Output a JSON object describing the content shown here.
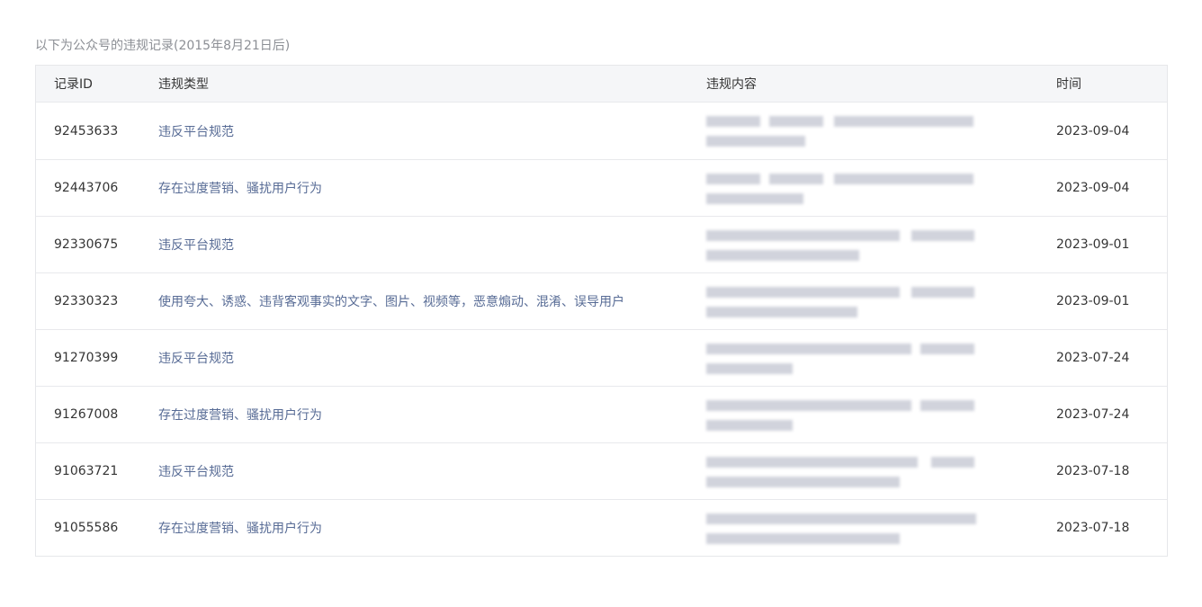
{
  "caption": "以下为公众号的违规记录(2015年8月21日后)",
  "table": {
    "columns": {
      "id": "记录ID",
      "type": "违规类型",
      "content": "违规内容",
      "time": "时间"
    },
    "rows": [
      {
        "id": "92453633",
        "type": "违反平台规范",
        "time": "2023-09-04"
      },
      {
        "id": "92443706",
        "type": "存在过度营销、骚扰用户行为",
        "time": "2023-09-04"
      },
      {
        "id": "92330675",
        "type": "违反平台规范",
        "time": "2023-09-01"
      },
      {
        "id": "92330323",
        "type": "使用夸大、诱惑、违背客观事实的文字、图片、视频等，恶意煽动、混淆、误导用户",
        "time": "2023-09-01"
      },
      {
        "id": "91270399",
        "type": "违反平台规范",
        "time": "2023-07-24"
      },
      {
        "id": "91267008",
        "type": "存在过度营销、骚扰用户行为",
        "time": "2023-07-24"
      },
      {
        "id": "91063721",
        "type": "违反平台规范",
        "time": "2023-07-18"
      },
      {
        "id": "91055586",
        "type": "存在过度营销、骚扰用户行为",
        "time": "2023-07-18"
      }
    ]
  }
}
